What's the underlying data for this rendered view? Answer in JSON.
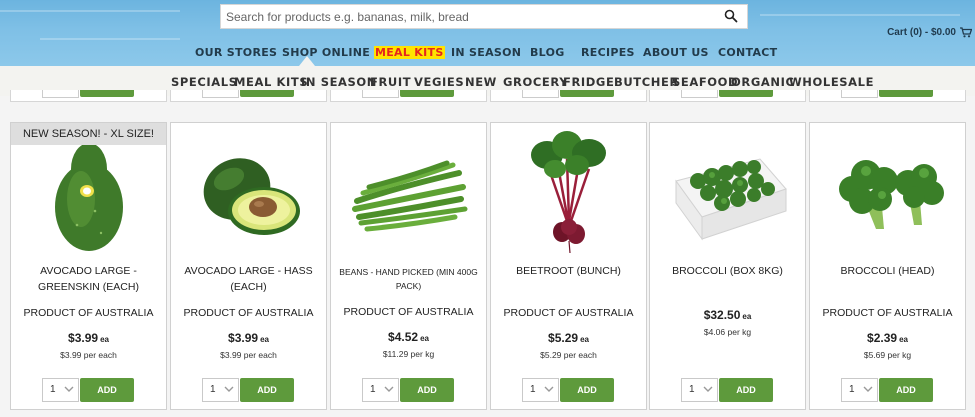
{
  "search": {
    "placeholder": "Search for products e.g. bananas, milk, bread",
    "value": ""
  },
  "cart": {
    "label": "Cart (0) - $0.00"
  },
  "main_nav": [
    {
      "label": "OUR STORES"
    },
    {
      "label": "SHOP ONLINE"
    },
    {
      "label": "MEAL KITS",
      "highlight": true
    },
    {
      "label": "IN SEASON"
    },
    {
      "label": "BLOG"
    },
    {
      "label": "RECIPES"
    },
    {
      "label": "ABOUT US"
    },
    {
      "label": "CONTACT"
    }
  ],
  "sub_nav": [
    {
      "label": "SPECIALS"
    },
    {
      "label": "MEAL KITS"
    },
    {
      "label": "IN SEASON"
    },
    {
      "label": "FRUIT"
    },
    {
      "label": "VEGIES"
    },
    {
      "label": "NEW"
    },
    {
      "label": "GROCERY"
    },
    {
      "label": "FRIDGE"
    },
    {
      "label": "BUTCHER"
    },
    {
      "label": "SEAFOOD"
    },
    {
      "label": "ORGANIC"
    },
    {
      "label": "WHOLESALE"
    }
  ],
  "colors": {
    "header_sky": "#7fc0e6",
    "nav_text": "#223b4b",
    "highlight_bg": "#ffe400",
    "highlight_text": "#e5261e",
    "add_button": "#5e9a3c",
    "badge_bg": "#dedede"
  },
  "products": [
    {
      "badge": "NEW SEASON! - XL SIZE!",
      "name": "AVOCADO LARGE - GREENSKIN (EACH)",
      "origin": "PRODUCT OF AUSTRALIA",
      "price": "$3.99",
      "price_unit": "ea",
      "unit_price": "$3.99 per each",
      "qty": "1",
      "add_label": "ADD",
      "icon": "avocado-greenskin-image"
    },
    {
      "badge": "",
      "name": "AVOCADO LARGE - HASS (EACH)",
      "origin": "PRODUCT OF AUSTRALIA",
      "price": "$3.99",
      "price_unit": "ea",
      "unit_price": "$3.99 per each",
      "qty": "1",
      "add_label": "ADD",
      "icon": "avocado-hass-image"
    },
    {
      "badge": "",
      "name": "BEANS - HAND PICKED (MIN 400G PACK)",
      "origin": "PRODUCT OF AUSTRALIA",
      "price": "$4.52",
      "price_unit": "ea",
      "unit_price": "$11.29 per kg",
      "qty": "1",
      "add_label": "ADD",
      "icon": "green-beans-image"
    },
    {
      "badge": "",
      "name": "BEETROOT (BUNCH)",
      "origin": "PRODUCT OF AUSTRALIA",
      "price": "$5.29",
      "price_unit": "ea",
      "unit_price": "$5.29 per each",
      "qty": "1",
      "add_label": "ADD",
      "icon": "beetroot-image"
    },
    {
      "badge": "",
      "name": "BROCCOLI (BOX 8KG)",
      "origin": "",
      "price": "$32.50",
      "price_unit": "ea",
      "unit_price": "$4.06 per kg",
      "qty": "1",
      "add_label": "ADD",
      "icon": "broccoli-box-image"
    },
    {
      "badge": "",
      "name": "BROCCOLI (HEAD)",
      "origin": "PRODUCT OF AUSTRALIA",
      "price": "$2.39",
      "price_unit": "ea",
      "unit_price": "$5.69 per kg",
      "qty": "1",
      "add_label": "ADD",
      "icon": "broccoli-head-image"
    }
  ]
}
